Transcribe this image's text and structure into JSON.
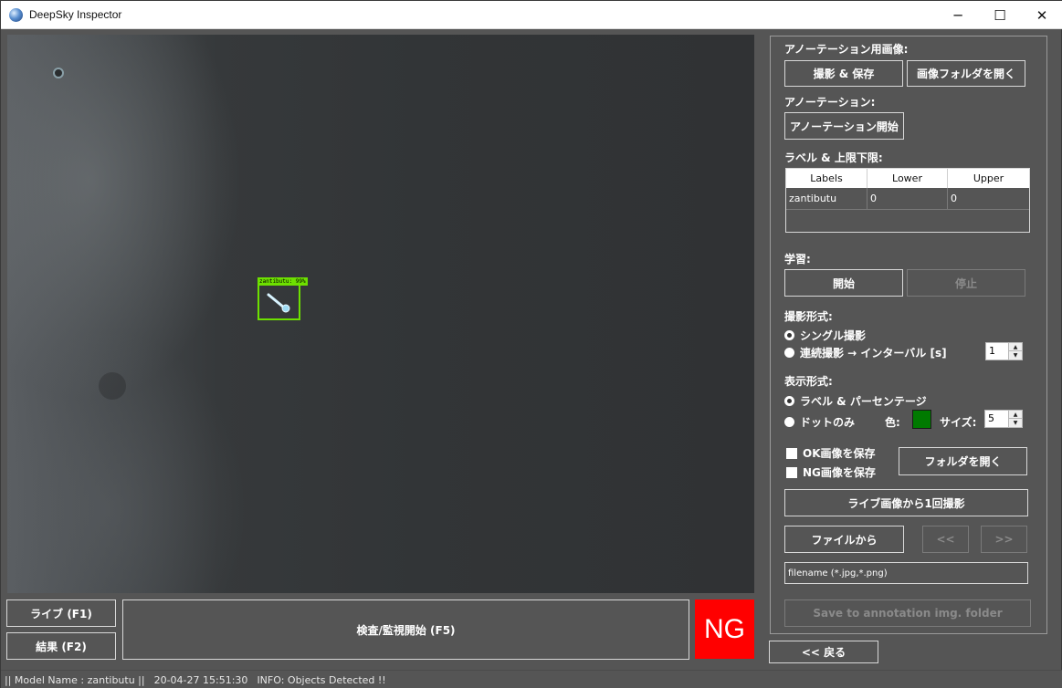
{
  "window": {
    "title": "DeepSky Inspector",
    "minimize_glyph": "─",
    "maximize_glyph": "☐",
    "close_glyph": "✕",
    "icon": "globe-icon"
  },
  "camera": {
    "detection_label": "zantibutu: 99%"
  },
  "bottom": {
    "live_label": "ライブ (F1)",
    "result_label": "結果 (F2)",
    "inspect_label": "検査/監視開始 (F5)",
    "verdict": "NG",
    "verdict_color": "#ff0000"
  },
  "panel": {
    "annotation_image_title": "アノーテーション用画像:",
    "capture_save_label": "撮影 & 保存",
    "open_image_folder_label": "画像フォルダを開く",
    "annotation_title": "アノーテーション:",
    "annotation_start_label": "アノーテーション開始",
    "labels_limits_title": "ラベル & 上限下限:",
    "table": {
      "headers": [
        "Labels",
        "Lower",
        "Upper"
      ],
      "rows": [
        [
          "zantibutu",
          "0",
          "0"
        ]
      ]
    },
    "training_title": "学習:",
    "train_start_label": "開始",
    "train_stop_label": "停止",
    "capture_mode_title": "撮影形式:",
    "capture_single_label": "シングル撮影",
    "capture_continuous_label": "連続撮影 → インターバル [s]",
    "interval_value": "1",
    "display_mode_title": "表示形式:",
    "display_label_percent": "ラベル & パーセンテージ",
    "display_dots_only": "ドットのみ",
    "color_label": "色:",
    "dot_color": "#007a00",
    "size_label": "サイズ:",
    "size_value": "5",
    "save_ok_label": "OK画像を保存",
    "save_ng_label": "NG画像を保存",
    "open_folder_label": "フォルダを開く",
    "capture_once_label": "ライブ画像から1回撮影",
    "from_file_label": "ファイルから",
    "prev_label": "<<",
    "next_label": ">>",
    "filename_text": "filename (*.jpg,*.png)",
    "save_annotation_label": "Save to annotation img. folder"
  },
  "back_label": "<< 戻る",
  "status": {
    "model": "|| Model Name : zantibutu ||",
    "timestamp": "20-04-27 15:51:30",
    "info": "INFO:  Objects Detected !!"
  }
}
